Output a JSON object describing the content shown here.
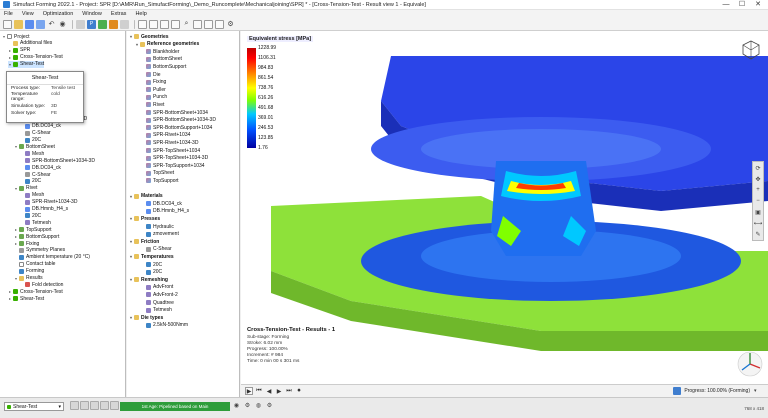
{
  "window": {
    "title": "Simufact Forming 2022.1 - Project: SPR [D:\\AMR\\Run_SimufactForming\\_Demo_Runcomplete\\Mechanicaljoining\\SPR] * - [Cross-Tension-Test - Result view 1 - Equivale]",
    "minimize": "—",
    "maximize": "☐",
    "close": "✕"
  },
  "menu": [
    "File",
    "View",
    "Optimization",
    "Window",
    "Extras",
    "Help"
  ],
  "project_tree": [
    {
      "label": "Project",
      "icon": "doc",
      "tw": "▾",
      "indent": 0
    },
    {
      "label": "Additional files",
      "icon": "folder",
      "tw": "",
      "indent": 1
    },
    {
      "label": "SPR",
      "icon": "green",
      "tw": "▸",
      "indent": 1
    },
    {
      "label": "Cross-Tension-Test",
      "icon": "green",
      "tw": "▸",
      "indent": 1
    },
    {
      "label": "Shear-Test",
      "icon": "green",
      "tw": "▾",
      "indent": 1,
      "selected": true
    },
    {
      "label": "",
      "icon": "",
      "tw": "",
      "indent": 0
    },
    {
      "label": "",
      "icon": "",
      "tw": "",
      "indent": 0
    },
    {
      "label": "",
      "icon": "",
      "tw": "",
      "indent": 0
    },
    {
      "label": "",
      "icon": "",
      "tw": "",
      "indent": 0
    },
    {
      "label": "",
      "icon": "",
      "tw": "",
      "indent": 0
    },
    {
      "label": "",
      "icon": "",
      "tw": "",
      "indent": 0
    },
    {
      "label": "",
      "icon": "",
      "tw": "",
      "indent": 0
    },
    {
      "label": "SPR-TopSheet+1034-3D",
      "icon": "mesh",
      "tw": "",
      "indent": 3
    },
    {
      "label": "DB.DC04_ck",
      "icon": "mat",
      "tw": "",
      "indent": 3
    },
    {
      "label": "C-Shear",
      "icon": "gray",
      "tw": "",
      "indent": 3
    },
    {
      "label": "20C",
      "icon": "proc",
      "tw": "",
      "indent": 3
    },
    {
      "label": "BottomSheet",
      "icon": "part",
      "tw": "▾",
      "indent": 2
    },
    {
      "label": "Mesh",
      "icon": "mesh",
      "tw": "",
      "indent": 3
    },
    {
      "label": "SPR-BottomSheet+1034-3D",
      "icon": "mesh",
      "tw": "",
      "indent": 3
    },
    {
      "label": "DB.DC04_ck",
      "icon": "mat",
      "tw": "",
      "indent": 3
    },
    {
      "label": "C-Shear",
      "icon": "gray",
      "tw": "",
      "indent": 3
    },
    {
      "label": "20C",
      "icon": "proc",
      "tw": "",
      "indent": 3
    },
    {
      "label": "Rivet",
      "icon": "part",
      "tw": "▾",
      "indent": 2
    },
    {
      "label": "Mesh",
      "icon": "mesh",
      "tw": "",
      "indent": 3
    },
    {
      "label": "SPR-Rivet+1034-3D",
      "icon": "mesh",
      "tw": "",
      "indent": 3
    },
    {
      "label": "DB.Hmnb_H4_s",
      "icon": "mat",
      "tw": "",
      "indent": 3
    },
    {
      "label": "20C",
      "icon": "proc",
      "tw": "",
      "indent": 3
    },
    {
      "label": "Tetmesh",
      "icon": "mesh",
      "tw": "",
      "indent": 3
    },
    {
      "label": "TopSupport",
      "icon": "part",
      "tw": "▸",
      "indent": 2
    },
    {
      "label": "BottomSupport",
      "icon": "part",
      "tw": "▸",
      "indent": 2
    },
    {
      "label": "Fixing",
      "icon": "part",
      "tw": "▸",
      "indent": 2
    },
    {
      "label": "Symmetry Planes",
      "icon": "gray",
      "tw": "",
      "indent": 2
    },
    {
      "label": "Ambient temperature (20 °C)",
      "icon": "proc",
      "tw": "",
      "indent": 2
    },
    {
      "label": "Contact table",
      "icon": "doc",
      "tw": "",
      "indent": 2
    },
    {
      "label": "Forming",
      "icon": "proc",
      "tw": "",
      "indent": 2
    },
    {
      "label": "Results",
      "icon": "folder",
      "tw": "▾",
      "indent": 2
    },
    {
      "label": "Fold detection",
      "icon": "red",
      "tw": "",
      "indent": 3
    },
    {
      "label": "Cross-Tension-Test",
      "icon": "green",
      "tw": "▸",
      "indent": 1
    },
    {
      "label": "Shear-Test",
      "icon": "green",
      "tw": "▸",
      "indent": 1
    }
  ],
  "tooltip": {
    "title": "Shear-Test",
    "rows": [
      {
        "k": "Process type:",
        "v": "Tensile test"
      },
      {
        "k": "Temperature range:",
        "v": "cold"
      },
      {
        "k": "Simulation type:",
        "v": "3D"
      },
      {
        "k": "Solver type:",
        "v": "FE"
      }
    ]
  },
  "library_tree": [
    {
      "label": "Geometries",
      "icon": "folder",
      "tw": "▾",
      "indent": 0,
      "bold": true
    },
    {
      "label": "Reference geometries",
      "icon": "folder",
      "tw": "▾",
      "indent": 1,
      "bold": true
    },
    {
      "label": "Blankholder",
      "icon": "geo",
      "tw": "",
      "indent": 2
    },
    {
      "label": "BottomSheet",
      "icon": "geo",
      "tw": "",
      "indent": 2
    },
    {
      "label": "BottomSupport",
      "icon": "geo",
      "tw": "",
      "indent": 2
    },
    {
      "label": "Die",
      "icon": "geo",
      "tw": "",
      "indent": 2
    },
    {
      "label": "Fixing",
      "icon": "geo",
      "tw": "",
      "indent": 2
    },
    {
      "label": "Puller",
      "icon": "geo",
      "tw": "",
      "indent": 2
    },
    {
      "label": "Punch",
      "icon": "geo",
      "tw": "",
      "indent": 2
    },
    {
      "label": "Rivet",
      "icon": "geo",
      "tw": "",
      "indent": 2
    },
    {
      "label": "SPR-BottomSheet+1034",
      "icon": "geo",
      "tw": "",
      "indent": 2
    },
    {
      "label": "SPR-BottomSheet+1034-3D",
      "icon": "geo",
      "tw": "",
      "indent": 2
    },
    {
      "label": "SPR-BottomSupport+1034",
      "icon": "geo",
      "tw": "",
      "indent": 2
    },
    {
      "label": "SPR-Rivet+1034",
      "icon": "geo",
      "tw": "",
      "indent": 2
    },
    {
      "label": "SPR-Rivet+1034-3D",
      "icon": "geo",
      "tw": "",
      "indent": 2
    },
    {
      "label": "SPR-TopSheet+1034",
      "icon": "geo",
      "tw": "",
      "indent": 2
    },
    {
      "label": "SPR-TopSheet+1034-3D",
      "icon": "geo",
      "tw": "",
      "indent": 2
    },
    {
      "label": "SPR-TopSupport+1034",
      "icon": "geo",
      "tw": "",
      "indent": 2
    },
    {
      "label": "TopSheet",
      "icon": "geo",
      "tw": "",
      "indent": 2
    },
    {
      "label": "TopSupport",
      "icon": "geo",
      "tw": "",
      "indent": 2
    },
    {
      "label": "",
      "icon": "",
      "tw": "",
      "indent": 0
    },
    {
      "label": "Materials",
      "icon": "folder",
      "tw": "▾",
      "indent": 0,
      "bold": true
    },
    {
      "label": "DB.DC04_ck",
      "icon": "mat",
      "tw": "",
      "indent": 2
    },
    {
      "label": "DB.Hmnb_H4_s",
      "icon": "mat",
      "tw": "",
      "indent": 2
    },
    {
      "label": "Presses",
      "icon": "folder",
      "tw": "▾",
      "indent": 0,
      "bold": true
    },
    {
      "label": "Hydraulic",
      "icon": "proc",
      "tw": "",
      "indent": 2
    },
    {
      "label": "zmovement",
      "icon": "proc",
      "tw": "",
      "indent": 2
    },
    {
      "label": "Friction",
      "icon": "folder",
      "tw": "▾",
      "indent": 0,
      "bold": true
    },
    {
      "label": "C-Shear",
      "icon": "gray",
      "tw": "",
      "indent": 2
    },
    {
      "label": "Temperatures",
      "icon": "folder",
      "tw": "▾",
      "indent": 0,
      "bold": true
    },
    {
      "label": "20C",
      "icon": "proc",
      "tw": "",
      "indent": 2
    },
    {
      "label": "20C",
      "icon": "proc",
      "tw": "",
      "indent": 2
    },
    {
      "label": "Remeshing",
      "icon": "folder",
      "tw": "▾",
      "indent": 0,
      "bold": true
    },
    {
      "label": "AdvFront",
      "icon": "mesh",
      "tw": "",
      "indent": 2
    },
    {
      "label": "AdvFront-2",
      "icon": "mesh",
      "tw": "",
      "indent": 2
    },
    {
      "label": "Quadtree",
      "icon": "mesh",
      "tw": "",
      "indent": 2
    },
    {
      "label": "Tetmesh",
      "icon": "mesh",
      "tw": "",
      "indent": 2
    },
    {
      "label": "Die types",
      "icon": "folder",
      "tw": "▾",
      "indent": 0,
      "bold": true
    },
    {
      "label": "2.5kN-500Nmm",
      "icon": "proc",
      "tw": "",
      "indent": 2
    }
  ],
  "viewport": {
    "legend_title": "Equivalent stress [MPa]",
    "legend_ticks": [
      "1228.99",
      "1106.31",
      "984.83",
      "861.54",
      "738.76",
      "616.26",
      "491.68",
      "369.01",
      "246.53",
      "123.85",
      "1.76"
    ],
    "colors": {
      "top_sheet": "#2b45e8",
      "bottom_sheet": "#8ee13a",
      "highlight": "#ff3b00"
    },
    "info_title": "Cross-Tension-Test - Results - 1",
    "info_lines": [
      "Sub-stage: Forming",
      "Stroke: 6.02 mm",
      "Progress: 100.00%",
      "Increment: # 984",
      "Time: 0 min 00 s 301 ms"
    ]
  },
  "animation": {
    "buttons": [
      "▶",
      "⏮",
      "◀",
      "▶",
      "⏭",
      "⏺"
    ],
    "progress_label": "Progress: 100.00% (Forming)"
  },
  "statusbar": {
    "selection": "Shear-Test",
    "green_bar_text": "1st Age: Pipelined based on Main",
    "right_text": "768 x 418"
  }
}
